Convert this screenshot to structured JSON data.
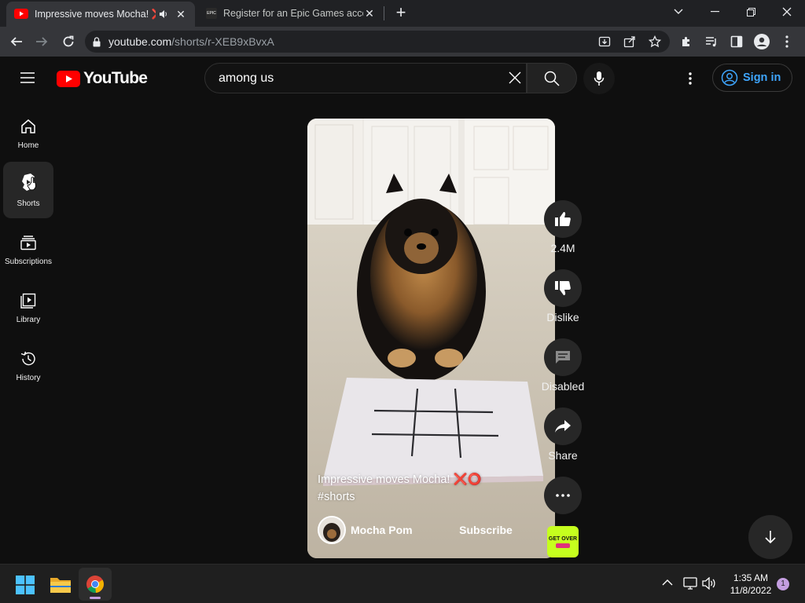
{
  "browser": {
    "tabs": [
      {
        "title": "Impressive moves Mocha! ❌⭕",
        "active": true,
        "audio": true
      },
      {
        "title": "Register for an Epic Games account",
        "active": false
      }
    ],
    "favicon_epic": "EPIC",
    "new_tab": "+",
    "url_host": "youtube.com",
    "url_path": "/shorts/r-XEB9xBvxA"
  },
  "youtube": {
    "logo_text": "YouTube",
    "search": {
      "value": "among us",
      "placeholder": "Search"
    },
    "signin_label": "Sign in",
    "guide": [
      {
        "label": "Home",
        "icon": "home-icon"
      },
      {
        "label": "Shorts",
        "icon": "shorts-icon",
        "active": true
      },
      {
        "label": "Subscriptions",
        "icon": "subscriptions-icon"
      },
      {
        "label": "Library",
        "icon": "library-icon"
      },
      {
        "label": "History",
        "icon": "history-icon"
      }
    ],
    "short": {
      "caption": "Impressive moves Mocha! ❌⭕",
      "hashtag": "#shorts",
      "channel": "Mocha Pom",
      "subscribe_label": "Subscribe"
    },
    "actions": {
      "like_count": "2.4M",
      "dislike_label": "Dislike",
      "comments_label": "Disabled",
      "share_label": "Share"
    },
    "sound_thumb_text": "GET OVER"
  },
  "taskbar": {
    "time": "1:35 AM",
    "date": "11/8/2022",
    "notifications": "1"
  },
  "colors": {
    "youtube_red": "#ff0000",
    "link_blue": "#3ea6ff",
    "background": "#0f0f0f"
  }
}
